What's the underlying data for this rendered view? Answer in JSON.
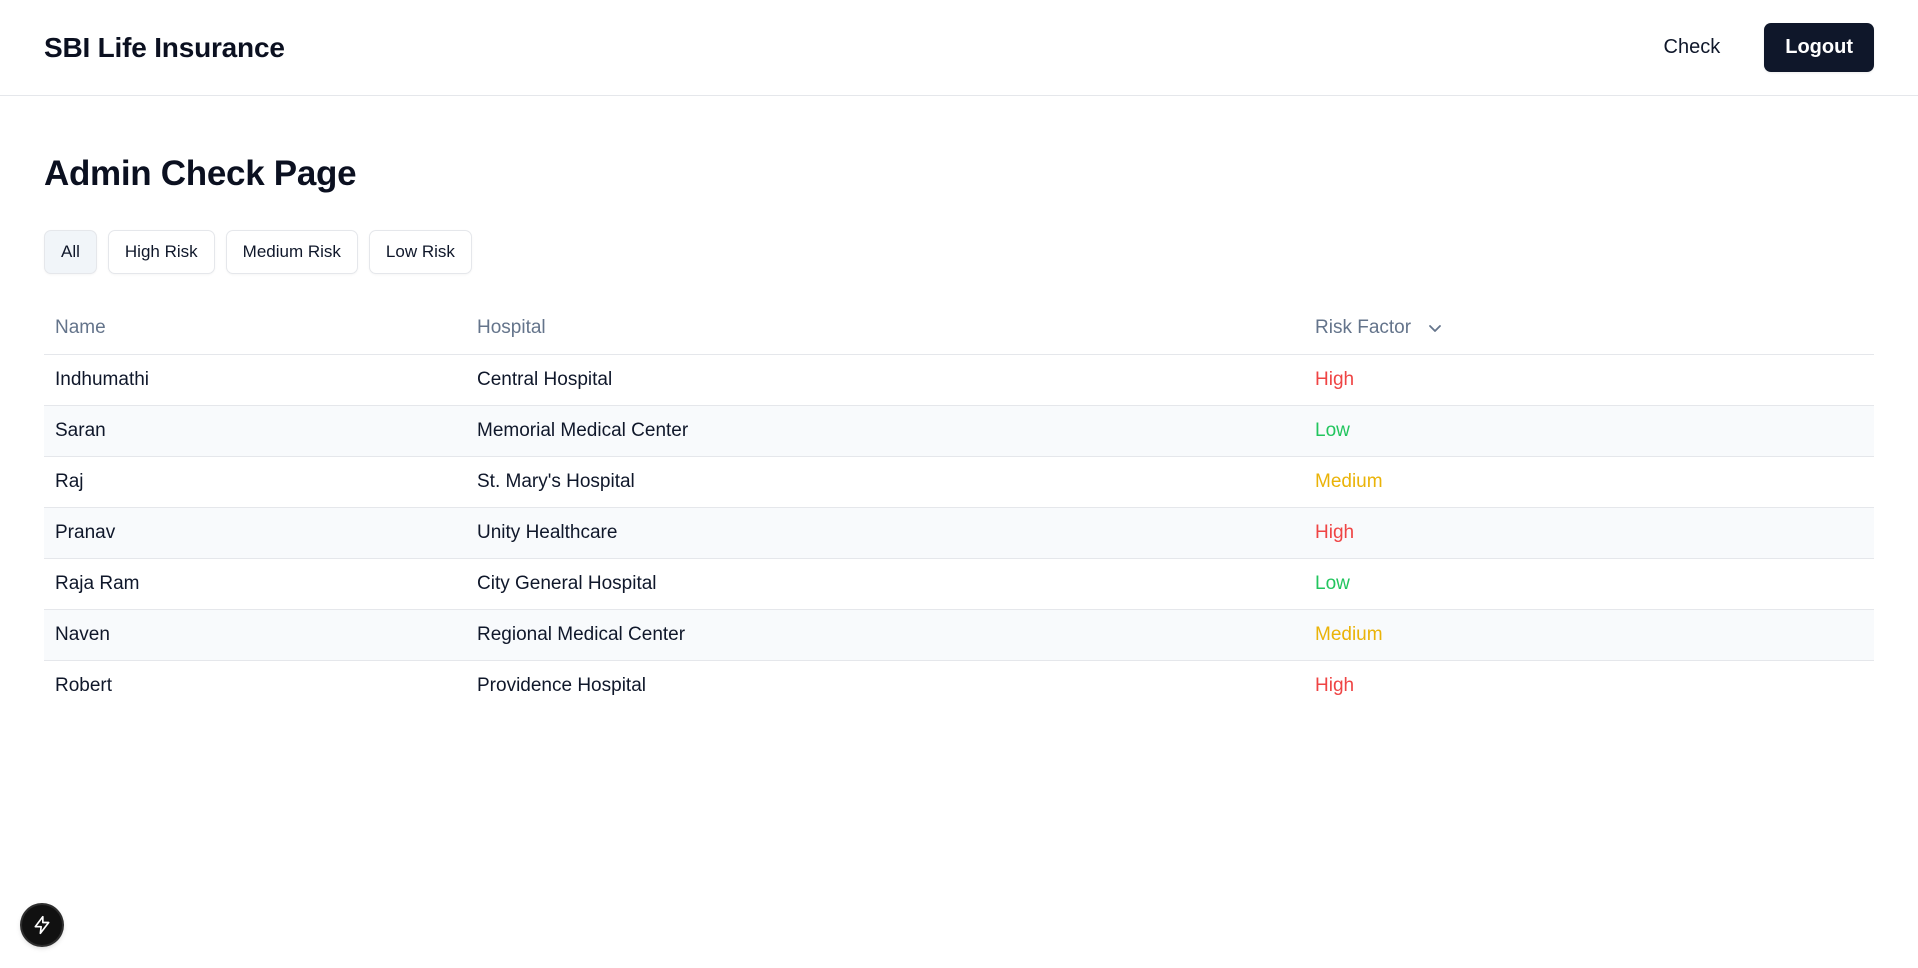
{
  "header": {
    "brand": "SBI Life Insurance",
    "nav_check": "Check",
    "logout_label": "Logout"
  },
  "page": {
    "title": "Admin Check Page"
  },
  "filters": [
    {
      "label": "All",
      "active": true
    },
    {
      "label": "High Risk",
      "active": false
    },
    {
      "label": "Medium Risk",
      "active": false
    },
    {
      "label": "Low Risk",
      "active": false
    }
  ],
  "table": {
    "columns": [
      "Name",
      "Hospital",
      "Risk Factor"
    ],
    "rows": [
      {
        "name": "Indhumathi",
        "hospital": "Central Hospital",
        "risk": "High"
      },
      {
        "name": "Saran",
        "hospital": "Memorial Medical Center",
        "risk": "Low"
      },
      {
        "name": "Raj",
        "hospital": "St. Mary's Hospital",
        "risk": "Medium"
      },
      {
        "name": "Pranav",
        "hospital": "Unity Healthcare",
        "risk": "High"
      },
      {
        "name": "Raja Ram",
        "hospital": "City General Hospital",
        "risk": "Low"
      },
      {
        "name": "Naven",
        "hospital": "Regional Medical Center",
        "risk": "Medium"
      },
      {
        "name": "Robert",
        "hospital": "Providence Hospital",
        "risk": "High"
      }
    ]
  },
  "colors": {
    "primary": "#0f172a",
    "risk_high": "#ef4444",
    "risk_medium": "#eab308",
    "risk_low": "#22c55e"
  },
  "icons": {
    "sort": "chevron-down-icon",
    "fab": "lightning-bolt-icon"
  }
}
